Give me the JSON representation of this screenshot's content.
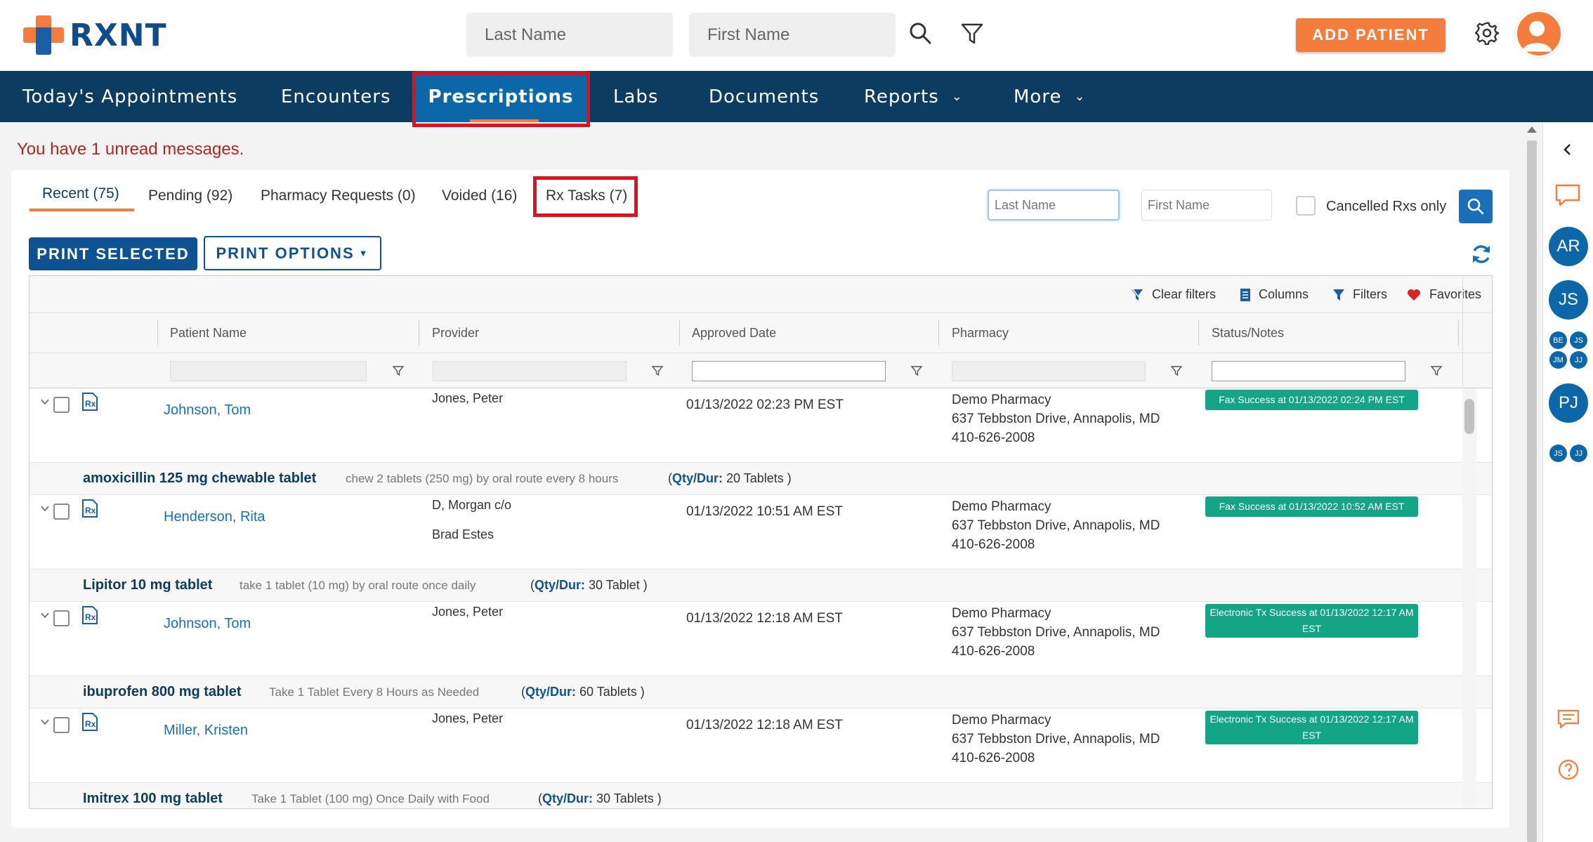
{
  "header": {
    "logo_text": "RXNT",
    "last_name_placeholder": "Last Name",
    "first_name_placeholder": "First Name",
    "add_patient_label": "ADD PATIENT"
  },
  "nav": {
    "items": [
      {
        "label": "Today's Appointments"
      },
      {
        "label": "Encounters"
      },
      {
        "label": "Prescriptions"
      },
      {
        "label": "Labs"
      },
      {
        "label": "Documents"
      },
      {
        "label": "Reports"
      },
      {
        "label": "More"
      }
    ]
  },
  "messages": {
    "unread_text": "You have 1 unread messages."
  },
  "tabs": [
    {
      "label": "Recent (75)"
    },
    {
      "label": "Pending (92)"
    },
    {
      "label": "Pharmacy Requests (0)"
    },
    {
      "label": "Voided (16)"
    },
    {
      "label": "Rx Tasks (7)"
    }
  ],
  "search": {
    "last_name_placeholder": "Last Name",
    "first_name_placeholder": "First Name",
    "cancelled_label": "Cancelled Rxs only"
  },
  "actions": {
    "print_selected": "PRINT SELECTED",
    "print_options": "PRINT OPTIONS"
  },
  "toolbar": {
    "clear_filters": "Clear filters",
    "columns": "Columns",
    "filters": "Filters",
    "favorites": "Favorites"
  },
  "columns": [
    "Patient Name",
    "Provider",
    "Approved Date",
    "Pharmacy",
    "Status/Notes"
  ],
  "rows": [
    {
      "patient": "Johnson, Tom",
      "provider_line1": "Jones, Peter",
      "provider_line2": "",
      "date": "01/13/2022 02:23 PM EST",
      "pharmacy_name": "Demo Pharmacy",
      "pharmacy_address": "637 Tebbston Drive, Annapolis, MD",
      "pharmacy_phone": "410-626-2008",
      "status": "Fax Success at 01/13/2022 02:24 PM EST",
      "drug": "amoxicillin 125 mg chewable tablet",
      "sig": "chew 2 tablets (250 mg) by oral route every 8 hours",
      "qty_label": "Qty/Dur:",
      "qty": "20 Tablets )"
    },
    {
      "patient": "Henderson, Rita",
      "provider_line1": "D, Morgan c/o",
      "provider_line2": "Brad Estes",
      "date": "01/13/2022 10:51 AM EST",
      "pharmacy_name": "Demo Pharmacy",
      "pharmacy_address": "637 Tebbston Drive, Annapolis, MD",
      "pharmacy_phone": "410-626-2008",
      "status": "Fax Success at 01/13/2022 10:52 AM EST",
      "drug": "Lipitor 10 mg tablet",
      "sig": "take 1 tablet (10 mg) by oral route once daily",
      "qty_label": "Qty/Dur:",
      "qty": "30 Tablet )"
    },
    {
      "patient": "Johnson, Tom",
      "provider_line1": "Jones, Peter",
      "provider_line2": "",
      "date": "01/13/2022 12:18 AM EST",
      "pharmacy_name": "Demo Pharmacy",
      "pharmacy_address": "637 Tebbston Drive, Annapolis, MD",
      "pharmacy_phone": "410-626-2008",
      "status": "Electronic Tx Success at 01/13/2022 12:17 AM EST",
      "drug": "ibuprofen 800 mg tablet",
      "sig": "Take 1 Tablet Every 8 Hours as Needed",
      "qty_label": "Qty/Dur:",
      "qty": "60 Tablets )"
    },
    {
      "patient": "Miller, Kristen",
      "provider_line1": "Jones, Peter",
      "provider_line2": "",
      "date": "01/13/2022 12:18 AM EST",
      "pharmacy_name": "Demo Pharmacy",
      "pharmacy_address": "637 Tebbston Drive, Annapolis, MD",
      "pharmacy_phone": "410-626-2008",
      "status": "Electronic Tx Success at 01/13/2022 12:17 AM EST",
      "drug": "Imitrex 100 mg tablet",
      "sig": "Take 1 Tablet (100 mg) Once Daily with Food",
      "qty_label": "Qty/Dur:",
      "qty": "30 Tablets )"
    }
  ],
  "sidebar": {
    "users": [
      "AR",
      "JS",
      "BE",
      "JS",
      "JM",
      "JJ",
      "PJ",
      "JS",
      "JJ"
    ]
  },
  "colors": {
    "brand_orange": "#f47c3c",
    "nav_bg": "#0d3c61",
    "nav_active": "#0b67a8",
    "status_green": "#14a585",
    "highlight_red": "#e0101e"
  }
}
